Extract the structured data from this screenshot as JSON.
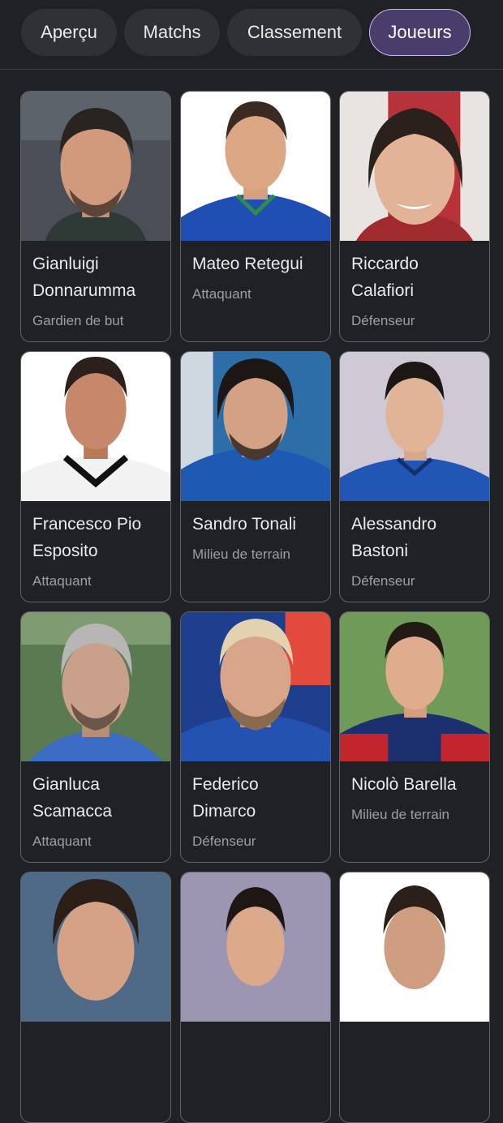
{
  "tabs": [
    {
      "label": "Aperçu",
      "active": false
    },
    {
      "label": "Matchs",
      "active": false
    },
    {
      "label": "Classement",
      "active": false
    },
    {
      "label": "Joueurs",
      "active": true
    }
  ],
  "players": [
    {
      "name": "Gianluigi Donnarumma",
      "role": "Gardien de but"
    },
    {
      "name": "Mateo Retegui",
      "role": "Attaquant"
    },
    {
      "name": "Riccardo Calafiori",
      "role": "Défenseur"
    },
    {
      "name": "Francesco Pio Esposito",
      "role": "Attaquant"
    },
    {
      "name": "Sandro Tonali",
      "role": "Milieu de terrain"
    },
    {
      "name": "Alessandro Bastoni",
      "role": "Défenseur"
    },
    {
      "name": "Gianluca Scamacca",
      "role": "Attaquant"
    },
    {
      "name": "Federico Dimarco",
      "role": "Défenseur"
    },
    {
      "name": "Nicolò Barella",
      "role": "Milieu de terrain"
    },
    {
      "name": "",
      "role": ""
    },
    {
      "name": "",
      "role": ""
    },
    {
      "name": "",
      "role": ""
    }
  ],
  "colors": {
    "background": "#202124",
    "tab_background": "#303134",
    "active_tab_background": "#4b3d6b",
    "active_tab_border": "#c9b8f2",
    "card_border": "#5f6368",
    "name_text": "#e8eaed",
    "role_text": "#9aa0a6"
  }
}
